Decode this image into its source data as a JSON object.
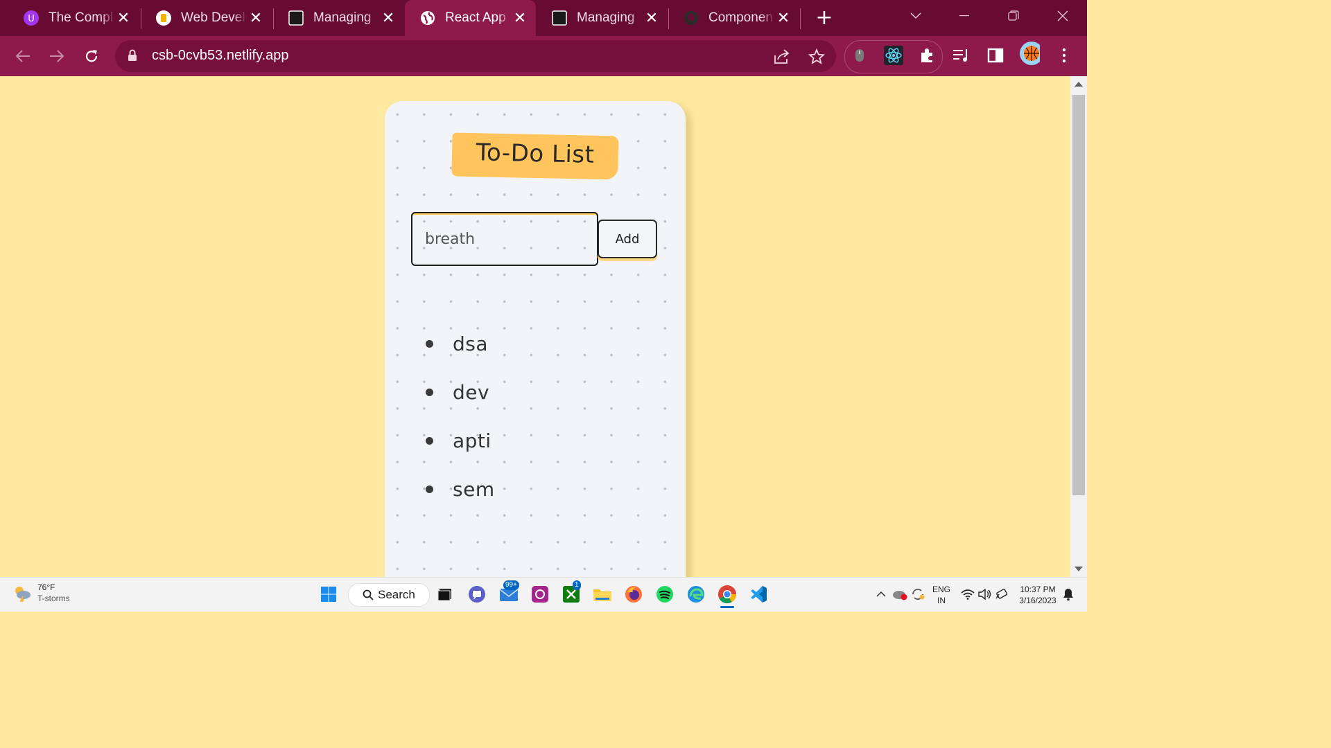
{
  "browser": {
    "tabs": [
      {
        "title": "The Complete",
        "icon": "udemy-icon",
        "active": false
      },
      {
        "title": "Web Development",
        "icon": "bootcamp-icon",
        "active": false
      },
      {
        "title": "Managing",
        "icon": "page-icon",
        "active": false
      },
      {
        "title": "React App",
        "icon": "globe-icon",
        "active": true
      },
      {
        "title": "Managing",
        "icon": "page-icon",
        "active": false
      },
      {
        "title": "Components",
        "icon": "github-icon",
        "active": false
      }
    ],
    "new_tab_label": "+",
    "url": "csb-0cvb53.netlify.app",
    "accent": "#8e1a4b",
    "tabstrip_color": "#680b33"
  },
  "app": {
    "title": "To-Do List",
    "input_value": "breath",
    "input_placeholder": "",
    "add_label": "Add",
    "items": [
      "dsa",
      "dev",
      "apti",
      "sem"
    ],
    "background": "#ffe9a0",
    "badge_color": "#ffc45c"
  },
  "taskbar": {
    "weather_temp": "76°F",
    "weather_desc": "T-storms",
    "search_label": "Search",
    "mail_badge": "99+",
    "xbox_badge": "1",
    "language_top": "ENG",
    "language_bottom": "IN",
    "time": "10:37 PM",
    "date": "3/16/2023"
  }
}
